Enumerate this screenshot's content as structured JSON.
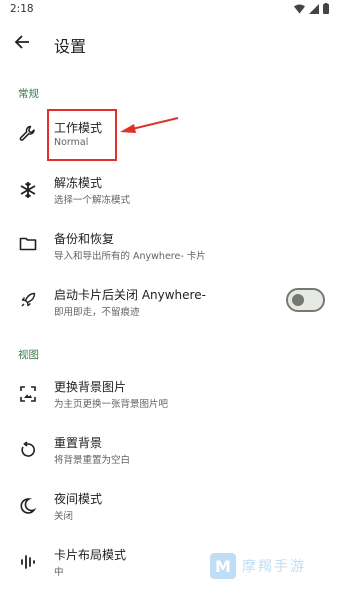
{
  "status_bar": {
    "time": "2:18",
    "icons": [
      "wifi-icon",
      "signal-icon",
      "battery-icon"
    ]
  },
  "app_bar": {
    "title": "设置",
    "back_icon": "arrow-left-icon"
  },
  "sections": {
    "general": "常规",
    "view": "视图"
  },
  "prefs": {
    "work_mode": {
      "title": "工作模式",
      "summary": "Normal",
      "icon": "wrench-icon"
    },
    "freeze_mode": {
      "title": "解冻模式",
      "summary": "选择一个解冻模式",
      "icon": "snowflake-icon"
    },
    "backup": {
      "title": "备份和恢复",
      "summary": "导入和导出所有的 Anywhere- 卡片",
      "icon": "folder-icon"
    },
    "close_after_launch": {
      "title": "启动卡片后关闭 Anywhere-",
      "summary": "即用即走，不留痕迹",
      "icon": "rocket-icon",
      "switch_on": false
    },
    "change_bg": {
      "title": "更换背景图片",
      "summary": "为主页更换一张背景图片吧",
      "icon": "image-frame-icon"
    },
    "reset_bg": {
      "title": "重置背景",
      "summary": "将背景重置为空白",
      "icon": "reset-icon"
    },
    "night_mode": {
      "title": "夜间模式",
      "summary": "关闭",
      "icon": "moon-icon"
    },
    "card_layout": {
      "title": "卡片布局模式",
      "summary": "中",
      "icon": "equalizer-icon"
    }
  },
  "colors": {
    "accent": "#3b7a49",
    "annotation": "#e0302a",
    "text_primary": "#202124",
    "text_secondary": "#5f6368"
  },
  "watermark_text": "摩羯手游"
}
